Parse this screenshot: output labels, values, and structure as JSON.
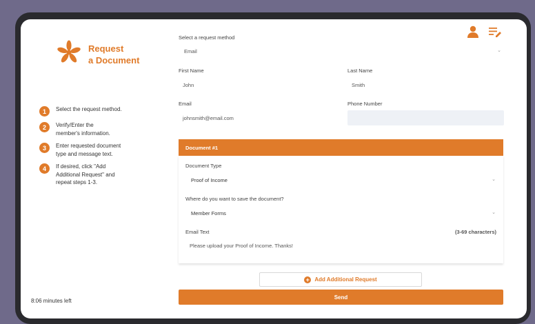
{
  "app": {
    "title_line1": "Request",
    "title_line2": "a Document",
    "accent": "#e07b2a"
  },
  "steps": [
    {
      "num": "1",
      "text": "Select the request method."
    },
    {
      "num": "2",
      "text": "Verify/Enter the member's information."
    },
    {
      "num": "3",
      "text": "Enter requested document type and message text."
    },
    {
      "num": "4",
      "text": "If desired, click \"Add Additional Request\" and repeat steps 1-3."
    }
  ],
  "time_left": "8:06 minutes left",
  "icons": {
    "profile": "user-icon",
    "list": "list-edit-icon",
    "logo": "asterisk-icon"
  },
  "form": {
    "method_label": "Select a request method",
    "method_value": "Email",
    "first_name_label": "First Name",
    "first_name_value": "John",
    "last_name_label": "Last Name",
    "last_name_value": "Smith",
    "email_label": "Email",
    "email_value": "johnsmith@email.com",
    "phone_label": "Phone Number",
    "phone_value": ""
  },
  "document": {
    "header": "Document #1",
    "type_label": "Document Type",
    "type_value": "Proof of Income",
    "save_label": "Where do you want to save the document?",
    "save_value": "Member Forms",
    "email_text_label": "Email Text",
    "char_hint": "(3-69 characters)",
    "email_text_value": "Please upload your Proof of Income. Thanks!"
  },
  "buttons": {
    "add_request": "Add Additional Request",
    "send": "Send"
  }
}
